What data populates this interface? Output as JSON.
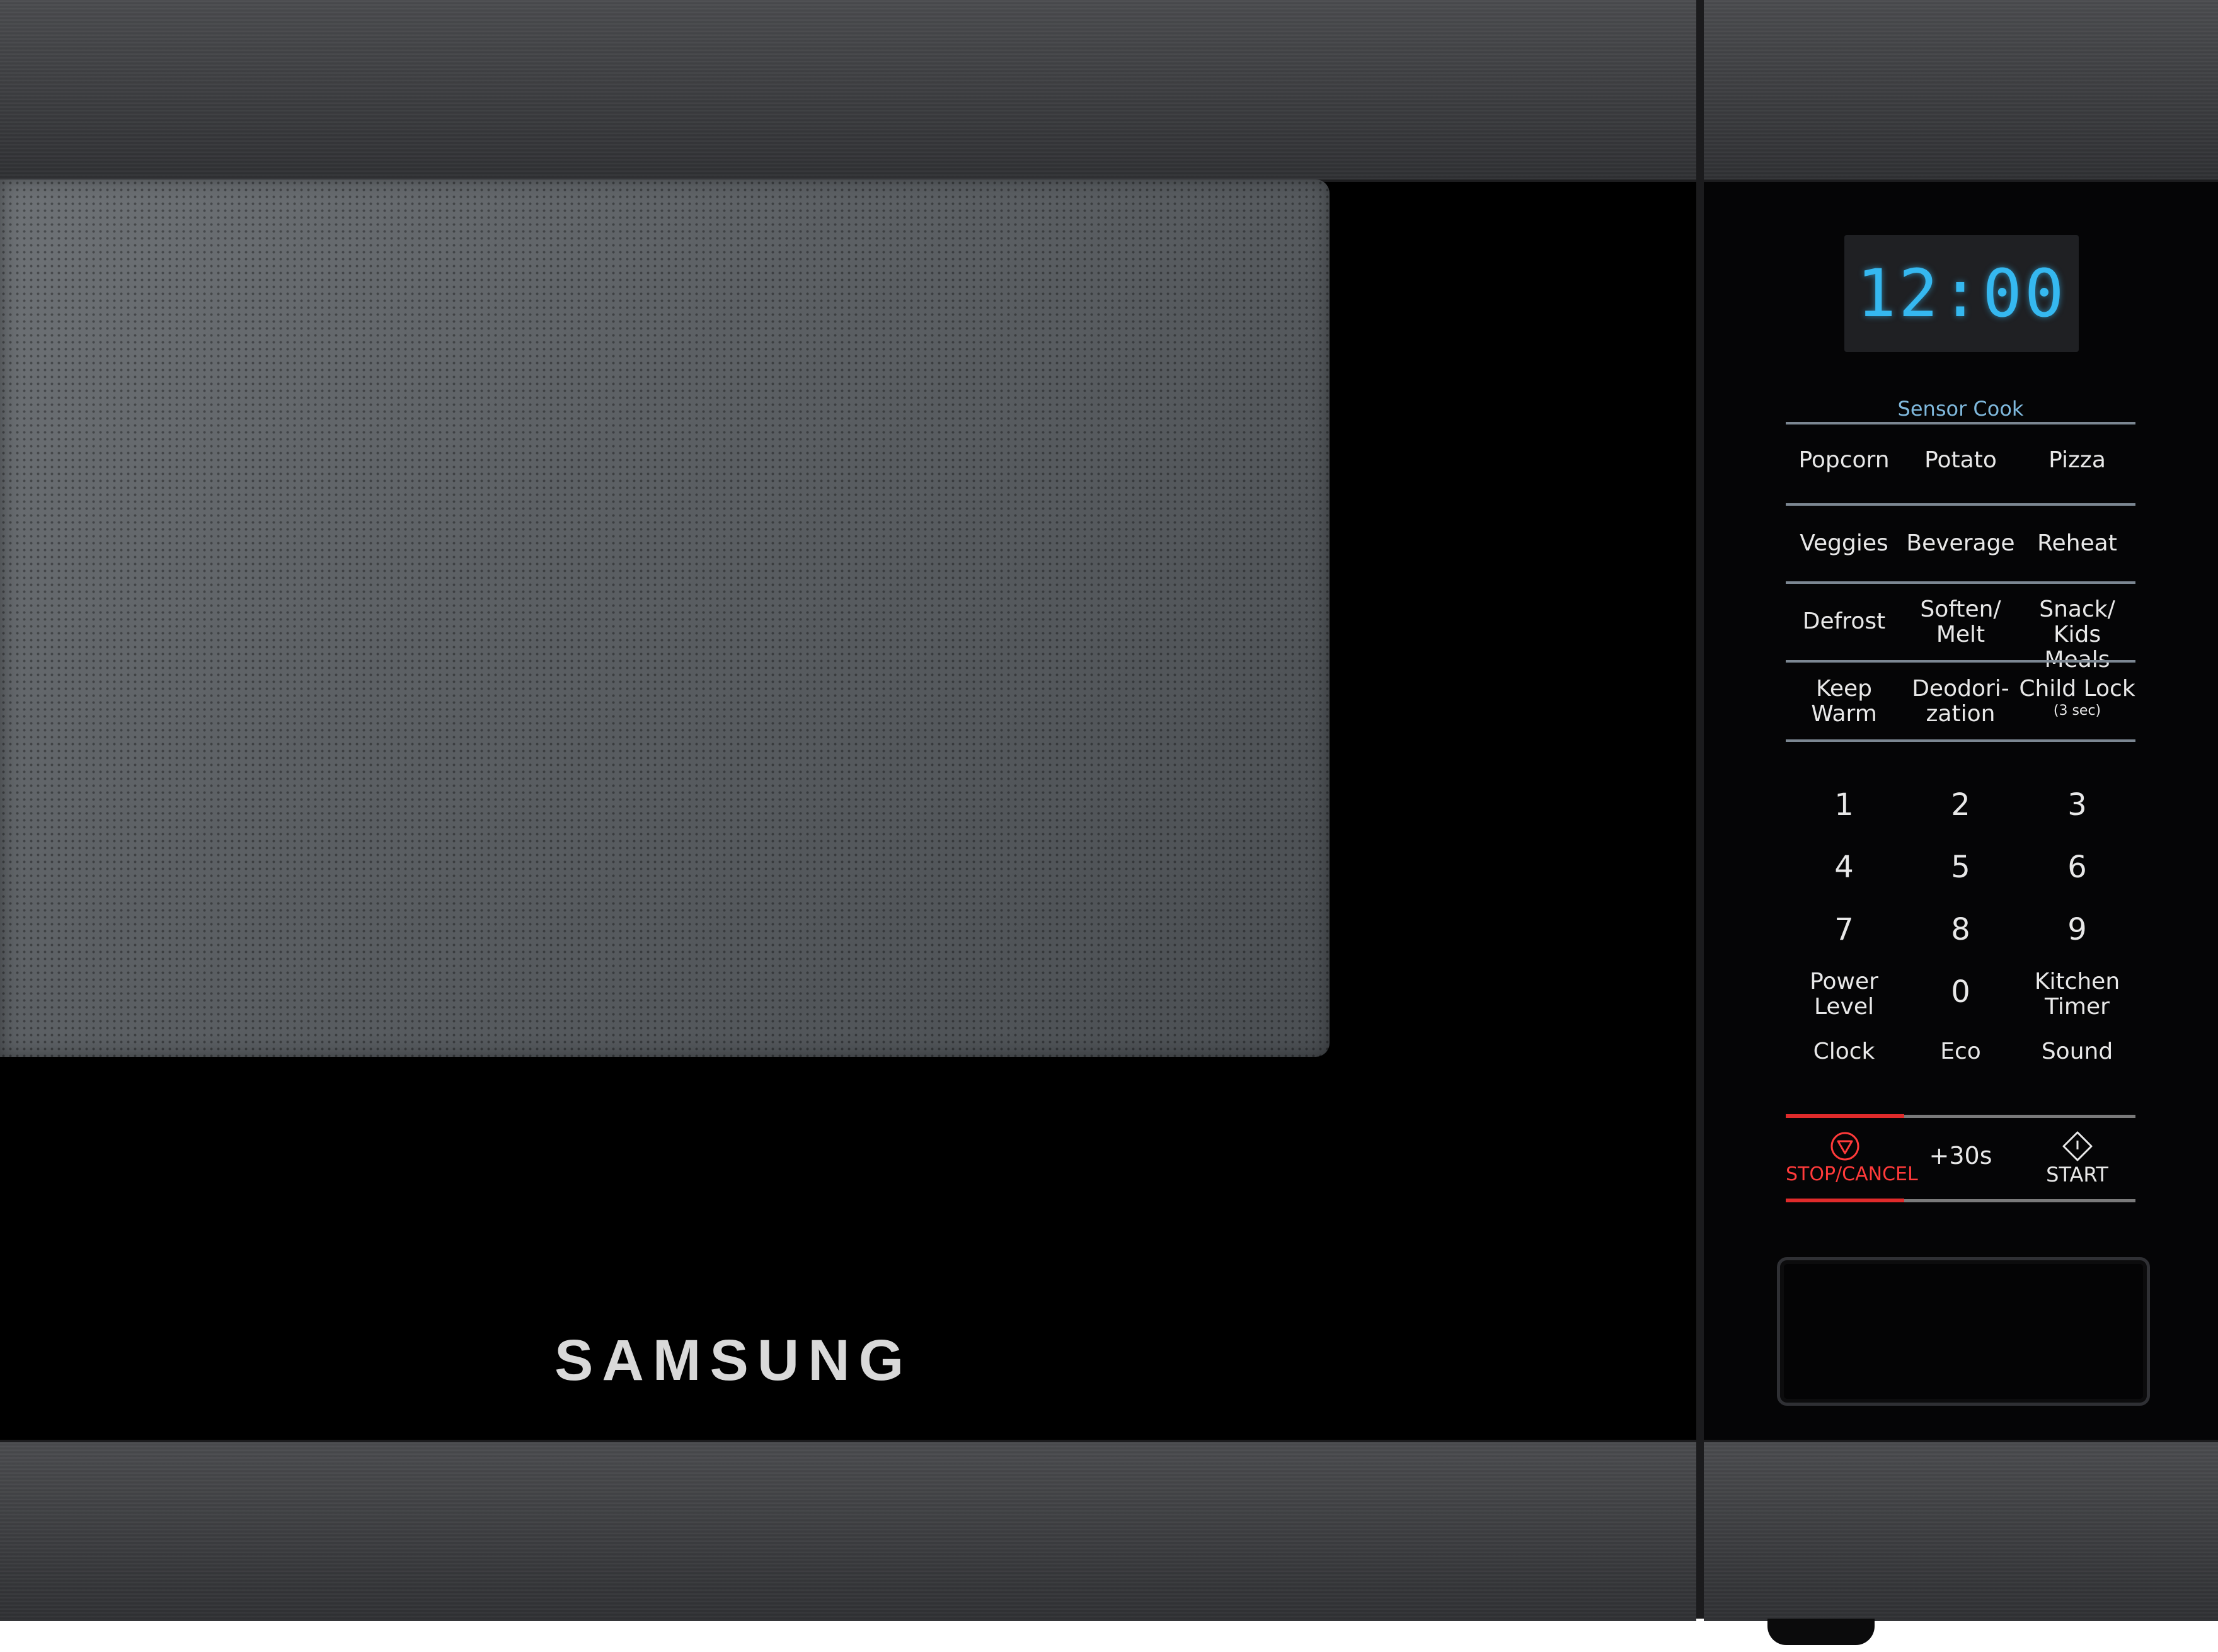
{
  "brand": "SAMSUNG",
  "display": {
    "time": "12:00",
    "color": "#35b8f0"
  },
  "panel": {
    "sensor_cook_label": "Sensor Cook",
    "row1": [
      "Popcorn",
      "Potato",
      "Pizza"
    ],
    "row2": [
      "Veggies",
      "Beverage",
      "Reheat"
    ],
    "row3": [
      "Defrost",
      "Soften/\nMelt",
      "Snack/\nKids Meals"
    ],
    "row4": {
      "keep_warm": "Keep\nWarm",
      "deodorization": "Deodori-\nzation",
      "child_lock": "Child Lock",
      "child_lock_note": "(3 sec)"
    },
    "numbers": [
      "1",
      "2",
      "3",
      "4",
      "5",
      "6",
      "7",
      "8",
      "9",
      "0"
    ],
    "power_level": "Power\nLevel",
    "kitchen_timer": "Kitchen\nTimer",
    "clock": "Clock",
    "eco": "Eco",
    "sound": "Sound",
    "stop_cancel": "STOP/CANCEL",
    "plus30": "+30s",
    "start": "START",
    "stop_color": "#e02b2b"
  }
}
